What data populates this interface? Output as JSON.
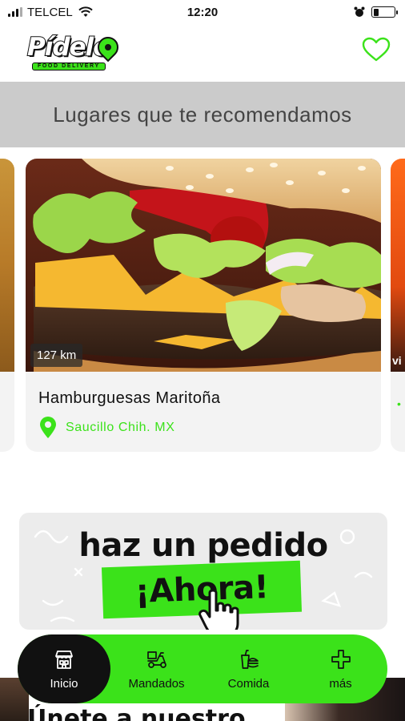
{
  "status_bar": {
    "carrier": "TELCEL",
    "time": "12:20",
    "battery_level": 0.25
  },
  "header": {
    "logo_text": "Pídelo",
    "logo_subtitle": "FOOD DELIVERY",
    "favorites_icon": "heart-outline-icon"
  },
  "section": {
    "title": "Lugares que te recomendamos"
  },
  "carousel": {
    "cards": [
      {
        "name": "Hamburguesas Maritoña",
        "location": "Saucillo Chih. MX",
        "distance": "127 km",
        "image": "hamburger-photo"
      }
    ],
    "peek_right_text": "vi"
  },
  "promo": {
    "line1": "haz un pedido",
    "line2": "¡Ahora!",
    "icon": "pointing-hand-icon"
  },
  "bottom": {
    "title": "Únete a nuestro"
  },
  "navbar": {
    "items": [
      {
        "label": "Inicio",
        "icon": "store-icon",
        "active": true
      },
      {
        "label": "Mandados",
        "icon": "delivery-scooter-icon",
        "active": false
      },
      {
        "label": "Comida",
        "icon": "food-icon",
        "active": false
      },
      {
        "label": "más",
        "icon": "plus-icon",
        "active": false
      }
    ]
  },
  "colors": {
    "accent": "#3be21a",
    "banner_bg": "#cbcbcb",
    "card_bg": "#f3f3f3",
    "dark": "#111111"
  }
}
